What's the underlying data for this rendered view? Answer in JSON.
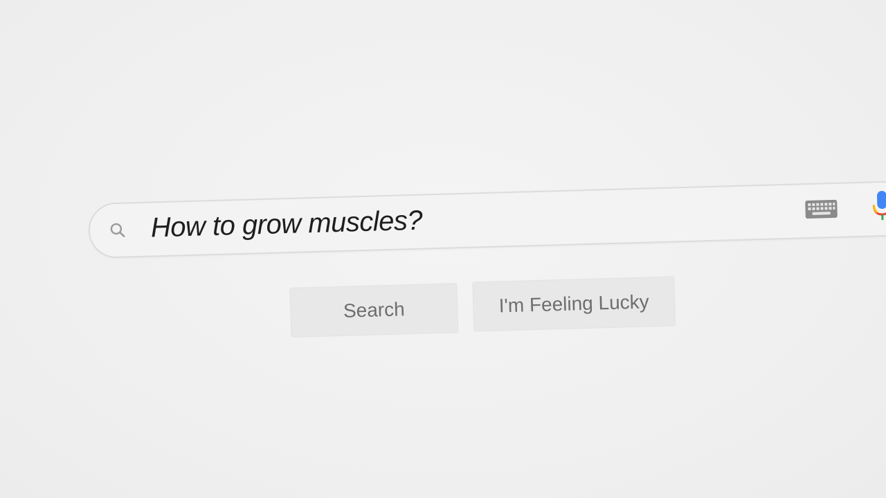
{
  "search": {
    "query": "How to grow muscles?"
  },
  "buttons": {
    "search_label": "Search",
    "lucky_label": "I'm Feeling Lucky"
  },
  "icons": {
    "search": "search-icon",
    "keyboard": "keyboard-icon",
    "mic": "microphone-icon"
  },
  "colors": {
    "background": "#f1f1f1",
    "text": "#1e1e1e",
    "button_text": "#6e6e6e",
    "mic_blue": "#4285f4",
    "mic_red": "#ea4335",
    "mic_yellow": "#fbbc05"
  }
}
